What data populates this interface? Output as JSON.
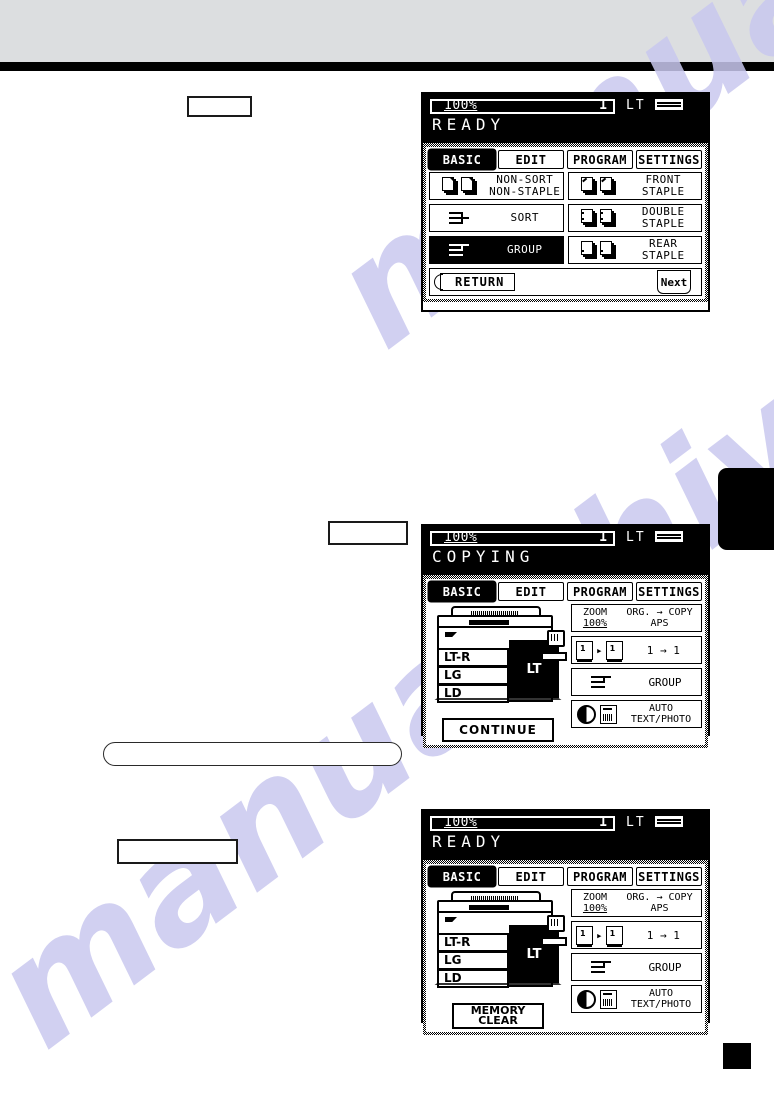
{
  "page": {
    "watermark_1": "manualshive.com",
    "watermark_2": "manualshive.com"
  },
  "panels": [
    {
      "id": "finisher-mode-screen",
      "header": {
        "ratio": "100%",
        "copy_count": "1",
        "paper_size": "LT",
        "paper_stack_icon": "paper-stack-icon",
        "status": "READY"
      },
      "tabs": [
        {
          "label": "BASIC",
          "selected": true
        },
        {
          "label": "EDIT",
          "selected": false
        },
        {
          "label": "PROGRAM",
          "selected": false
        },
        {
          "label": "SETTINGS",
          "selected": false
        }
      ],
      "left_buttons": [
        {
          "label": "NON-SORT\nNON-STAPLE",
          "line1": "NON-SORT",
          "line2": "NON-STAPLE",
          "icon": "two-page-stacks-icon",
          "selected": false
        },
        {
          "label": "SORT",
          "icon": "sort-icon",
          "selected": false
        },
        {
          "label": "GROUP",
          "icon": "group-icon",
          "selected": true
        }
      ],
      "right_buttons": [
        {
          "label": "FRONT STAPLE",
          "icon": "front-staple-icon",
          "selected": false
        },
        {
          "label": "DOUBLE STAPLE",
          "icon": "double-staple-icon",
          "selected": false
        },
        {
          "label": "REAR  STAPLE",
          "icon": "rear-staple-icon",
          "selected": false
        }
      ],
      "footer": {
        "return_label": "RETURN",
        "next_label": "Next"
      }
    },
    {
      "id": "copying-screen",
      "header": {
        "ratio": "100%",
        "copy_count": "1",
        "paper_size": "LT",
        "paper_stack_icon": "paper-stack-icon",
        "status": "COPYING"
      },
      "tabs": [
        {
          "label": "BASIC",
          "selected": true
        },
        {
          "label": "EDIT",
          "selected": false
        },
        {
          "label": "PROGRAM",
          "selected": false
        },
        {
          "label": "SETTINGS",
          "selected": false
        }
      ],
      "machine": {
        "drawers": [
          "LT-R",
          "LG",
          "LD"
        ],
        "selected_drawer": "LT"
      },
      "action_button": {
        "label": "CONTINUE",
        "line1": "CONTINUE",
        "line2": ""
      },
      "right_buttons": [
        {
          "name": "zoom-ratio",
          "zoom_label": "ZOOM",
          "zoom_value": "100%",
          "org_copy_label": "ORG. → COPY",
          "aps_label": "APS"
        },
        {
          "name": "duplex-mode",
          "value": "1 → 1",
          "icon_from": "single-page-icon",
          "icon_to": "page-stack-icon"
        },
        {
          "name": "finisher-mode",
          "label": "GROUP",
          "icon": "group-icon"
        },
        {
          "name": "exposure-mode",
          "line1": "AUTO",
          "line2": "TEXT/PHOTO",
          "icon_contrast": "contrast-icon",
          "icon_photo": "text-photo-icon"
        }
      ]
    },
    {
      "id": "ready-memory-clear-screen",
      "header": {
        "ratio": "100%",
        "copy_count": "1",
        "paper_size": "LT",
        "paper_stack_icon": "paper-stack-icon",
        "status": "READY"
      },
      "tabs": [
        {
          "label": "BASIC",
          "selected": true
        },
        {
          "label": "EDIT",
          "selected": false
        },
        {
          "label": "PROGRAM",
          "selected": false
        },
        {
          "label": "SETTINGS",
          "selected": false
        }
      ],
      "machine": {
        "drawers": [
          "LT-R",
          "LG",
          "LD"
        ],
        "selected_drawer": "LT"
      },
      "action_button": {
        "label": "MEMORY CLEAR",
        "line1": "MEMORY",
        "line2": "CLEAR"
      },
      "right_buttons": [
        {
          "name": "zoom-ratio",
          "zoom_label": "ZOOM",
          "zoom_value": "100%",
          "org_copy_label": "ORG. → COPY",
          "aps_label": "APS"
        },
        {
          "name": "duplex-mode",
          "value": "1 → 1",
          "icon_from": "single-page-icon",
          "icon_to": "page-stack-icon"
        },
        {
          "name": "finisher-mode",
          "label": "GROUP",
          "icon": "group-icon"
        },
        {
          "name": "exposure-mode",
          "line1": "AUTO",
          "line2": "TEXT/PHOTO",
          "icon_contrast": "contrast-icon",
          "icon_photo": "text-photo-icon"
        }
      ]
    }
  ],
  "caption_boxes": [
    {
      "name": "caption-box-step-1",
      "text": ""
    },
    {
      "name": "caption-box-step-2",
      "text": ""
    },
    {
      "name": "caption-note-box",
      "text": ""
    },
    {
      "name": "caption-box-step-3",
      "text": ""
    }
  ],
  "colors": {
    "page_top_band": "#dcdee0",
    "rule": "#000000",
    "lcd_background": "#ffffff",
    "lcd_header": "#000000",
    "watermark": "#c9c8ef"
  }
}
